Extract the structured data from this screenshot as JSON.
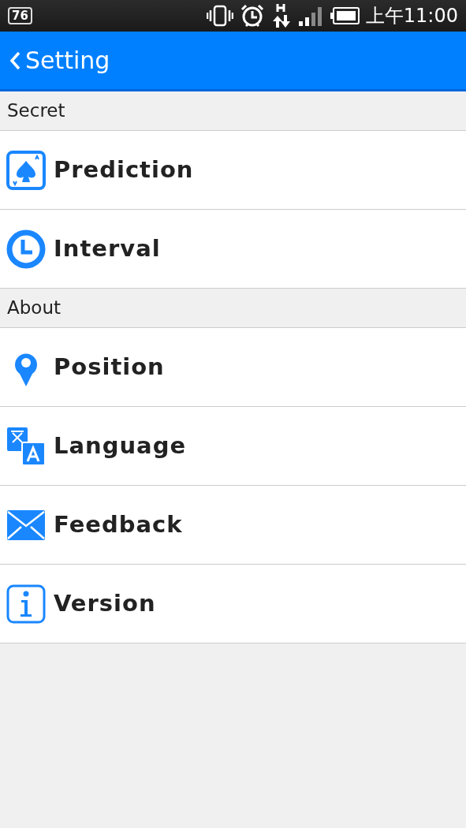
{
  "status_bar": {
    "notification_badge": "76",
    "time": "上午11:00"
  },
  "header": {
    "title": "Setting"
  },
  "sections": [
    {
      "title": "Secret",
      "items": [
        {
          "label": "Prediction",
          "kind": "card"
        },
        {
          "label": "Interval",
          "kind": "clock"
        }
      ]
    },
    {
      "title": "About",
      "items": [
        {
          "label": "Position",
          "kind": "pin"
        },
        {
          "label": "Language",
          "kind": "translate"
        },
        {
          "label": "Feedback",
          "kind": "mail"
        },
        {
          "label": "Version",
          "kind": "info"
        }
      ]
    }
  ]
}
